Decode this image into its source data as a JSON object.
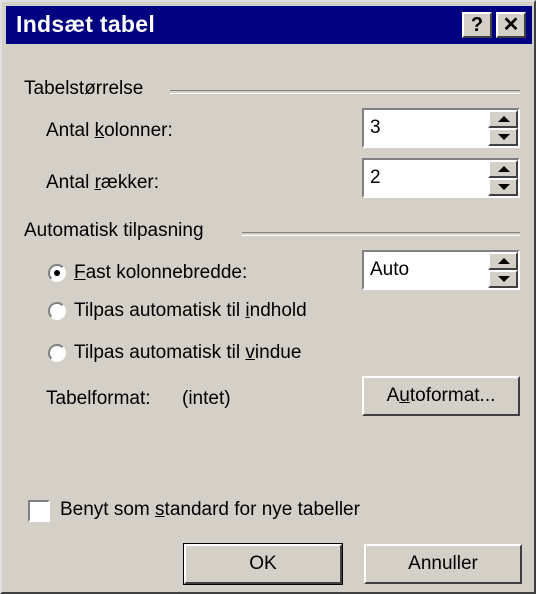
{
  "title": "Indsæt tabel",
  "titlebar": {
    "help_label": "?",
    "close_label": "✕"
  },
  "table_size": {
    "group_label": "Tabelstørrelse",
    "columns": {
      "label_pre": "Antal ",
      "label_u": "k",
      "label_post": "olonner:",
      "value": "3"
    },
    "rows": {
      "label_pre": "Antal ",
      "label_u": "r",
      "label_post": "ækker:",
      "value": "2"
    }
  },
  "autofit": {
    "group_label": "Automatisk tilpasning",
    "fixed": {
      "label_u": "F",
      "label_post": "ast kolonnebredde:",
      "value": "Auto",
      "selected": true
    },
    "content": {
      "label_pre": "Tilpas automatisk til ",
      "label_u": "i",
      "label_post": "ndhold"
    },
    "window": {
      "label_pre": "Tilpas automatisk til ",
      "label_u": "v",
      "label_post": "indue"
    }
  },
  "table_format": {
    "label": "Tabelformat:",
    "value": "(intet)",
    "button_pre": "A",
    "button_u": "u",
    "button_post": "toformat..."
  },
  "default_check": {
    "label_pre": "Benyt som ",
    "label_u": "s",
    "label_post": "tandard for nye tabeller",
    "checked": false
  },
  "buttons": {
    "ok": "OK",
    "cancel": "Annuller"
  }
}
